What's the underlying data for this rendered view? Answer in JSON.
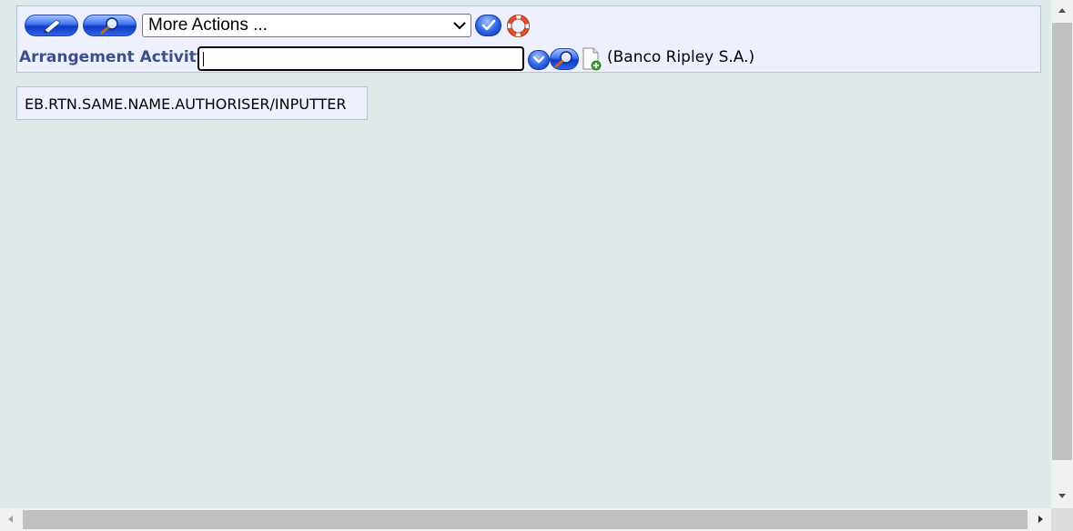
{
  "toolbar": {
    "edit_icon": "pencil-icon",
    "view_icon": "magnifier-icon",
    "more_actions_value": "More Actions ...",
    "go_icon": "checkmark-icon",
    "help_icon": "lifebuoy-icon"
  },
  "record": {
    "field_label": "Arrangement Activity",
    "field_value": "",
    "dropdown_icon": "chevron-down-icon",
    "search_icon": "magnifier-icon",
    "new_icon": "new-document-icon",
    "company": "(Banco Ripley S.A.)"
  },
  "message": {
    "text": "EB.RTN.SAME.NAME.AUTHORISER/INPUTTER"
  },
  "colors": {
    "background": "#e1eaea",
    "toolbar_bg": "#eef1fd",
    "label": "#3a4f8c",
    "button_blue": "#2c64e8"
  }
}
